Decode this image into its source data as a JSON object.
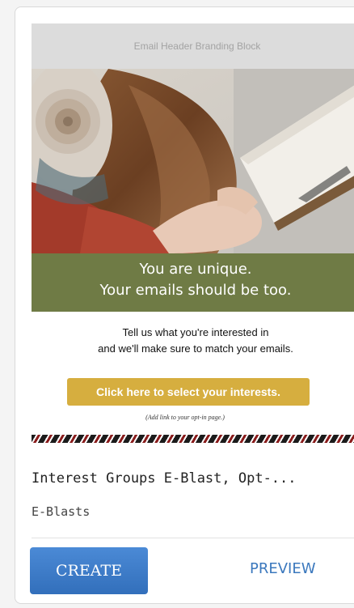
{
  "template_card": {
    "email_preview": {
      "header_text": "Email Header Branding Block",
      "headline_line1": "You are unique.",
      "headline_line2": "Your emails should be too.",
      "body_line1": "Tell us what you're interested in",
      "body_line2": "and we'll make sure to match your emails.",
      "cta_label": "Click here to select your interests.",
      "note": "(Add link to your opt-in page.)",
      "hero_image": "woman-reading-book-photo"
    },
    "title": "Interest Groups E-Blast, Opt-...",
    "category": "E-Blasts",
    "actions": {
      "create_label": "CREATE",
      "preview_label": "PREVIEW"
    },
    "colors": {
      "banner_green": "#6f7b45",
      "cta_gold": "#d6ae3f",
      "create_blue": "#3a79c7",
      "preview_blue": "#3b78bd"
    }
  }
}
